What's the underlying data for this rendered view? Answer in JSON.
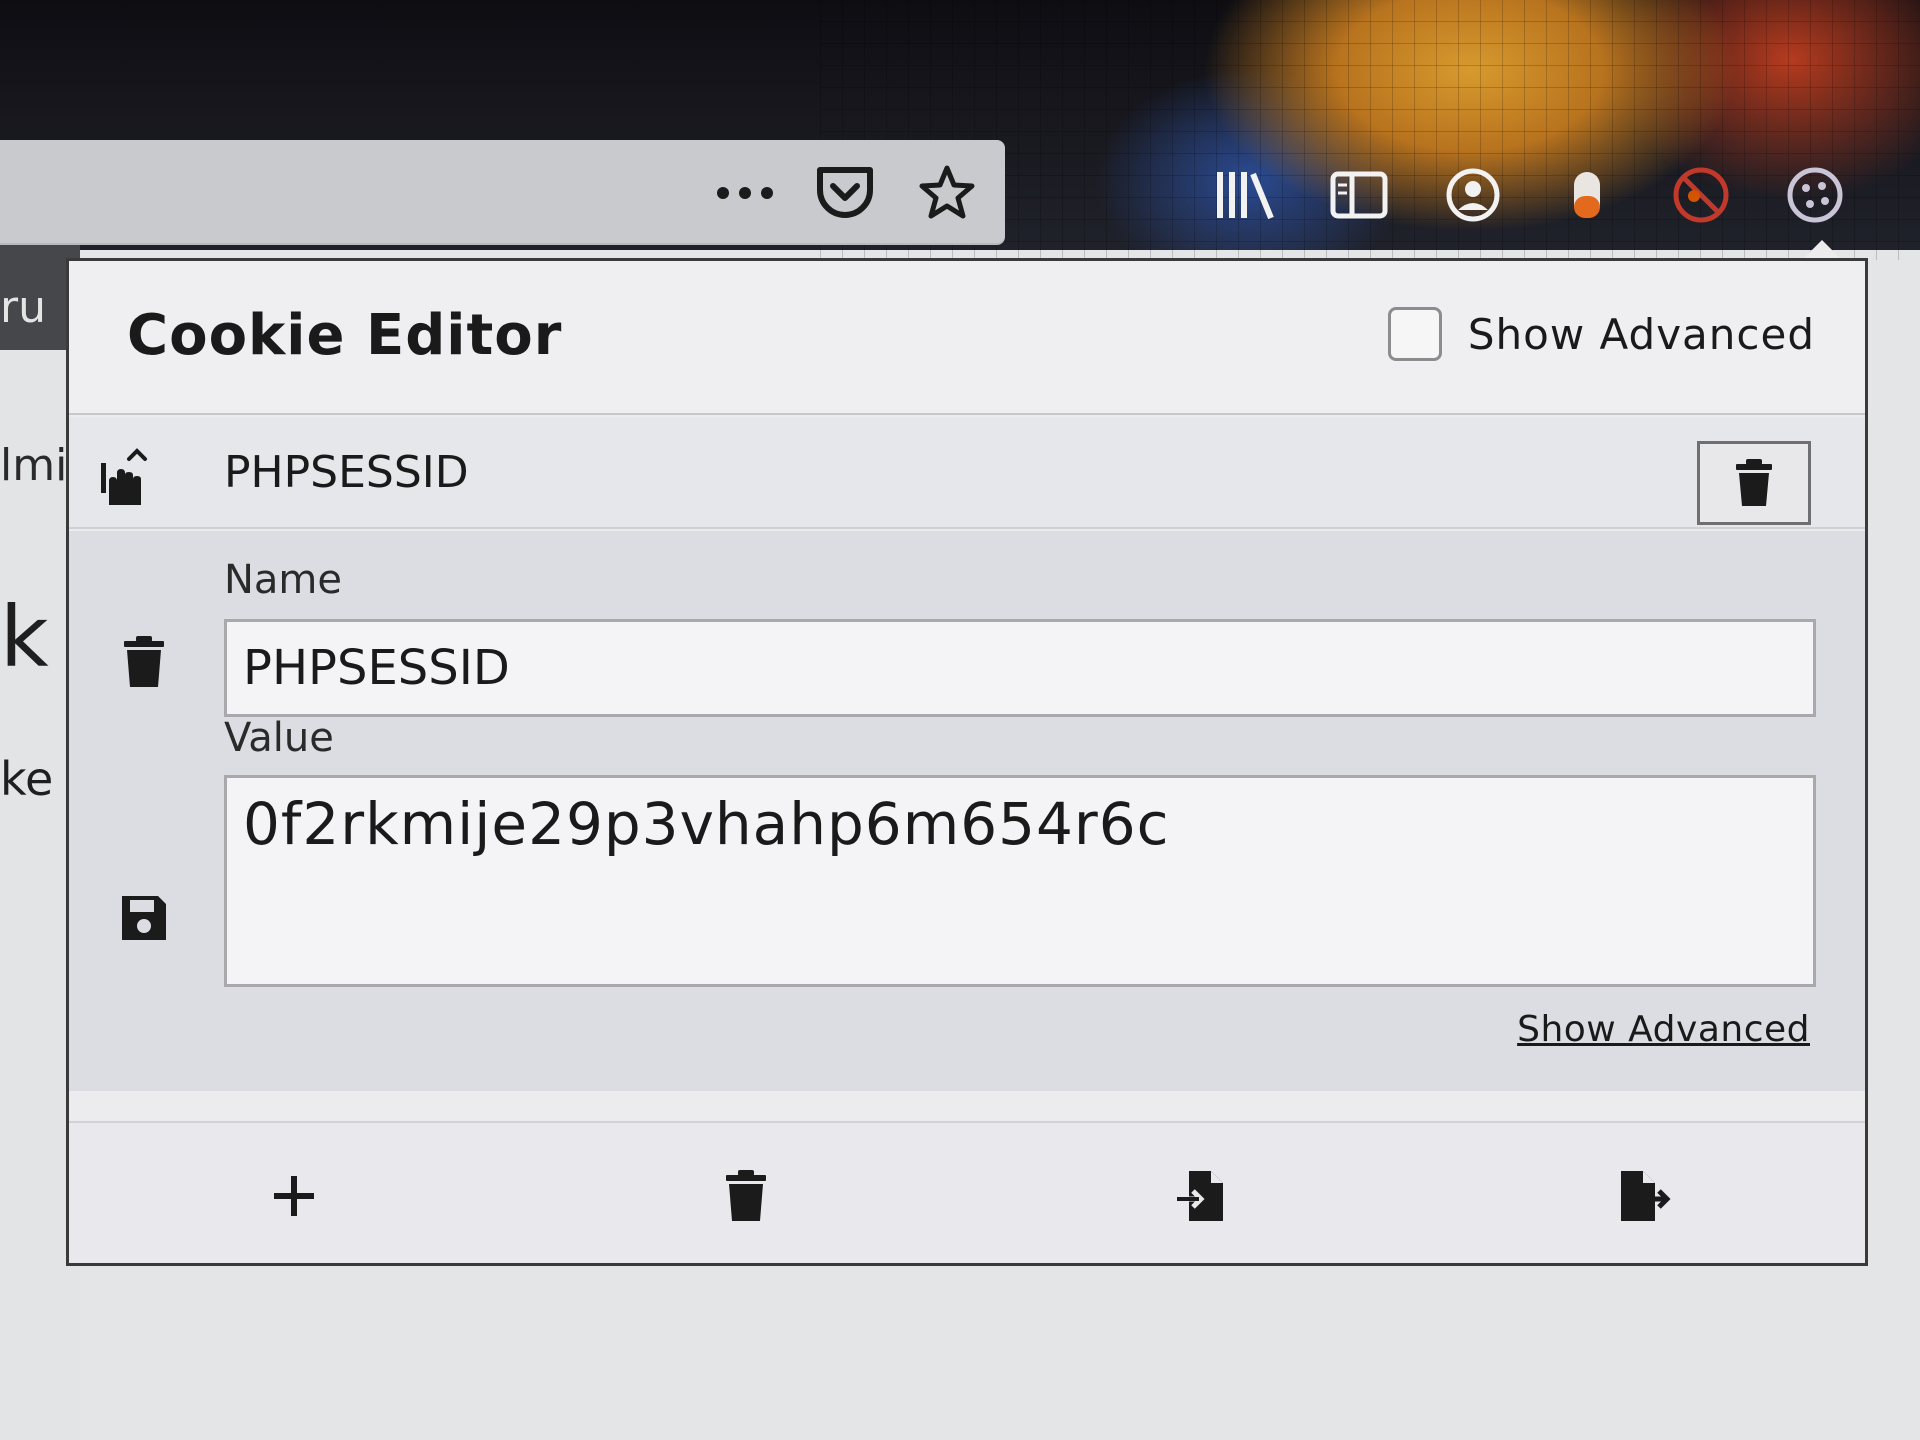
{
  "toolbar": {
    "url_icons": [
      "more-icon",
      "pocket-icon",
      "bookmark-star-icon"
    ],
    "right_icons": [
      "library-icon",
      "reader-view-icon",
      "account-icon",
      "extension-icon",
      "blocked-extension-icon",
      "cookie-icon"
    ]
  },
  "background_page": {
    "fragments": [
      "ru",
      "lmi",
      "k",
      "ke"
    ]
  },
  "popup": {
    "title": "Cookie Editor",
    "show_advanced_label": "Show Advanced",
    "show_advanced_checked": false,
    "cookie": {
      "name": "PHPSESSID",
      "fields": {
        "name_label": "Name",
        "name_value": "PHPSESSID",
        "value_label": "Value",
        "value_value": "0f2rkmije29p3vhahp6m654r6c"
      },
      "show_advanced_link": "Show Advanced"
    },
    "footer_actions": [
      "add-icon",
      "delete-all-icon",
      "import-icon",
      "export-icon"
    ]
  }
}
